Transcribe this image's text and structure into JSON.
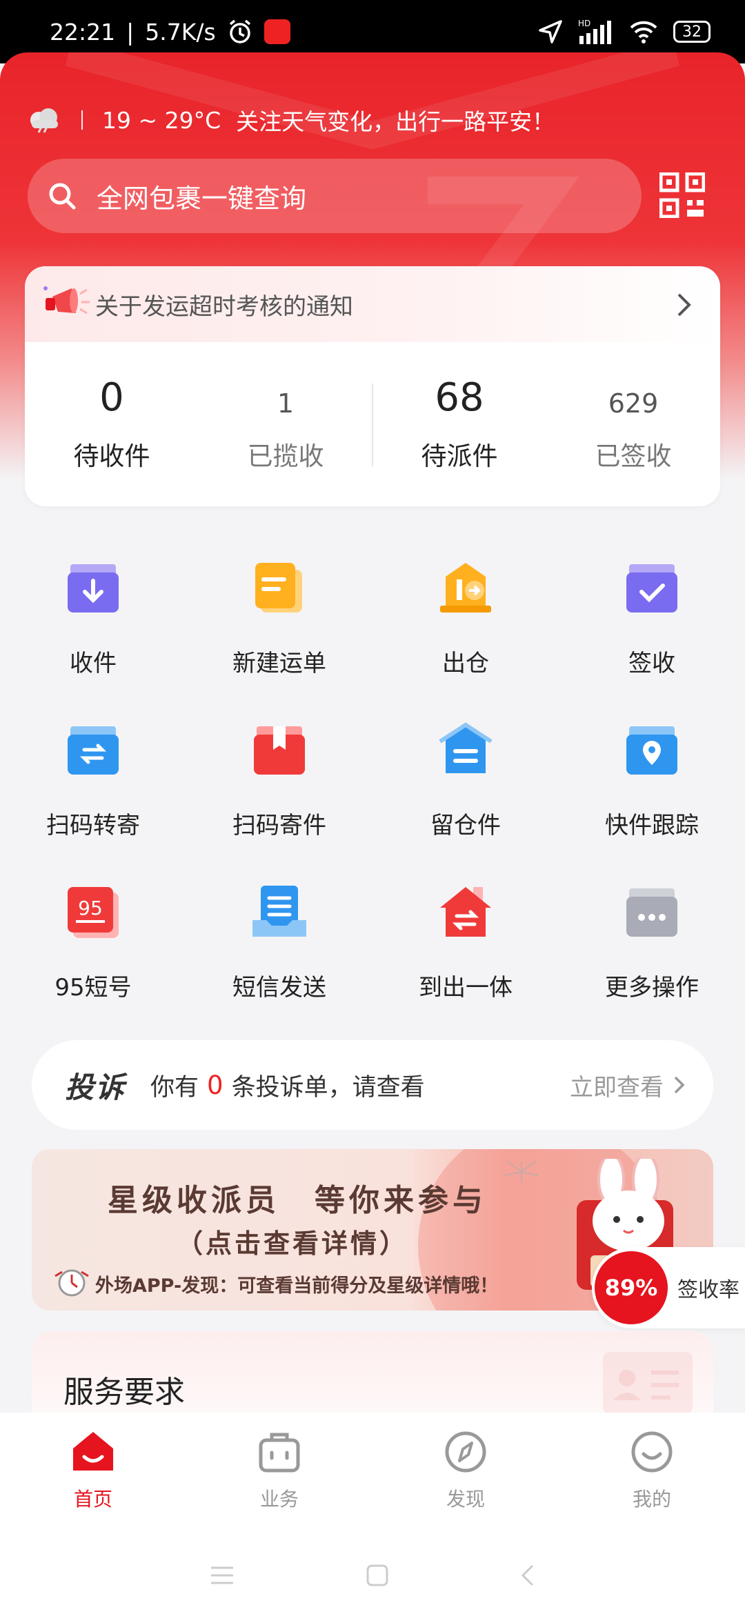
{
  "status_bar": {
    "time": "22:21",
    "speed": "5.7K/s",
    "battery": "32",
    "network": "HD"
  },
  "weather": {
    "temp_range": "19 ~ 29°C",
    "message": "关注天气变化，出行一路平安！"
  },
  "search": {
    "placeholder": "全网包裹一键查询"
  },
  "notice": {
    "text": "关于发运超时考核的通知"
  },
  "stats": [
    {
      "value": "0",
      "label": "待收件"
    },
    {
      "value": "1",
      "label": "已揽收"
    },
    {
      "value": "68",
      "label": "待派件"
    },
    {
      "value": "629",
      "label": "已签收"
    }
  ],
  "grid": [
    {
      "label": "收件",
      "icon": "inbox-download-icon",
      "color": "#7a6cf0"
    },
    {
      "label": "新建运单",
      "icon": "document-icon",
      "color": "#ffb01f"
    },
    {
      "label": "出仓",
      "icon": "warehouse-out-icon",
      "color": "#ffb01f"
    },
    {
      "label": "签收",
      "icon": "sign-check-icon",
      "color": "#7a6cf0"
    },
    {
      "label": "扫码转寄",
      "icon": "forward-box-icon",
      "color": "#2f96f0"
    },
    {
      "label": "扫码寄件",
      "icon": "package-icon",
      "color": "#f03a3a"
    },
    {
      "label": "留仓件",
      "icon": "hold-box-icon",
      "color": "#2f96f0"
    },
    {
      "label": "快件跟踪",
      "icon": "location-box-icon",
      "color": "#2f96f0"
    },
    {
      "label": "95短号",
      "icon": "short-number-icon",
      "color": "#f03a3a"
    },
    {
      "label": "短信发送",
      "icon": "sms-icon",
      "color": "#2f96f0"
    },
    {
      "label": "到出一体",
      "icon": "house-exchange-icon",
      "color": "#f03a3a"
    },
    {
      "label": "更多操作",
      "icon": "more-icon",
      "color": "#a9acb6"
    }
  ],
  "complaint": {
    "brand": "投诉",
    "prefix": "你有",
    "count": "0",
    "suffix": "条投诉单，请查看",
    "action": "立即查看"
  },
  "banner": {
    "line1": "星级收派员　等你来参与",
    "line2": "（点击查看详情）",
    "line3": "外场APP-发现：可查看当前得分及星级详情哦！"
  },
  "sign_rate": {
    "value": "89%",
    "label": "签收率"
  },
  "service": {
    "title": "服务要求"
  },
  "tabs": [
    {
      "label": "首页",
      "active": true
    },
    {
      "label": "业务",
      "active": false
    },
    {
      "label": "发现",
      "active": false
    },
    {
      "label": "我的",
      "active": false
    }
  ],
  "colors": {
    "brand_red": "#e5141e",
    "header_red": "#e8242a"
  }
}
